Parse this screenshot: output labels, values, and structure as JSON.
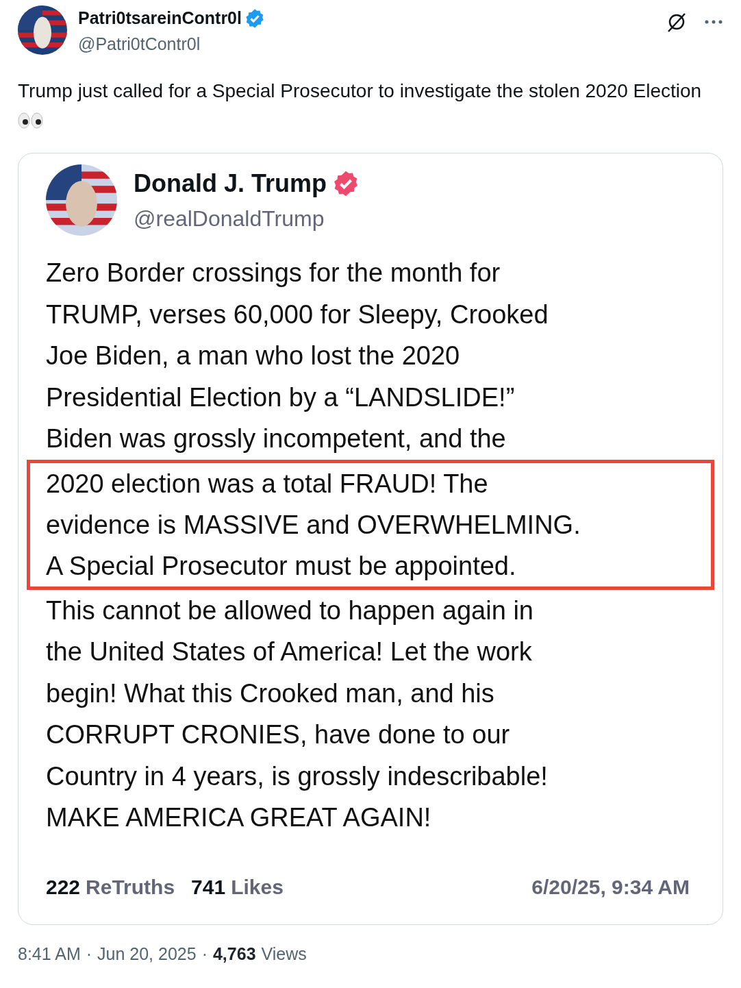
{
  "author": {
    "name": "Patri0tsareinContr0l",
    "handle": "@Patri0tContr0l",
    "verified": true
  },
  "text": "Trump just called for a Special Prosecutor to investigate the stolen 2020 Election",
  "quoted": {
    "name": "Donald J. Trump",
    "handle": "@realDonaldTrump",
    "verified": true,
    "segments": [
      {
        "highlighted": false,
        "lines": [
          "Zero Border crossings for the month for",
          "TRUMP, verses 60,000 for Sleepy, Crooked",
          "Joe Biden, a man who lost the 2020",
          "Presidential Election by a “LANDSLIDE!”",
          "Biden was grossly incompetent, and the"
        ]
      },
      {
        "highlighted": true,
        "lines": [
          "2020 election was a total FRAUD! The",
          "evidence is MASSIVE and OVERWHELMING.",
          "A Special Prosecutor must be appointed."
        ]
      },
      {
        "highlighted": false,
        "lines": [
          "This cannot be allowed to happen again in",
          "the United States of America! Let the work",
          "begin! What this Crooked man, and his",
          "CORRUPT CRONIES, have done to our",
          "Country in 4 years, is grossly indescribable!",
          "MAKE AMERICA GREAT AGAIN!"
        ]
      }
    ],
    "stats": [
      {
        "count": "222",
        "label": "ReTruths"
      },
      {
        "count": "741",
        "label": "Likes"
      }
    ],
    "timestamp": "6/20/25, 9:34 AM"
  },
  "meta": {
    "time": "8:41 AM",
    "separator": "·",
    "date": "Jun 20, 2025",
    "views": "4,763",
    "views_label": "Views"
  }
}
